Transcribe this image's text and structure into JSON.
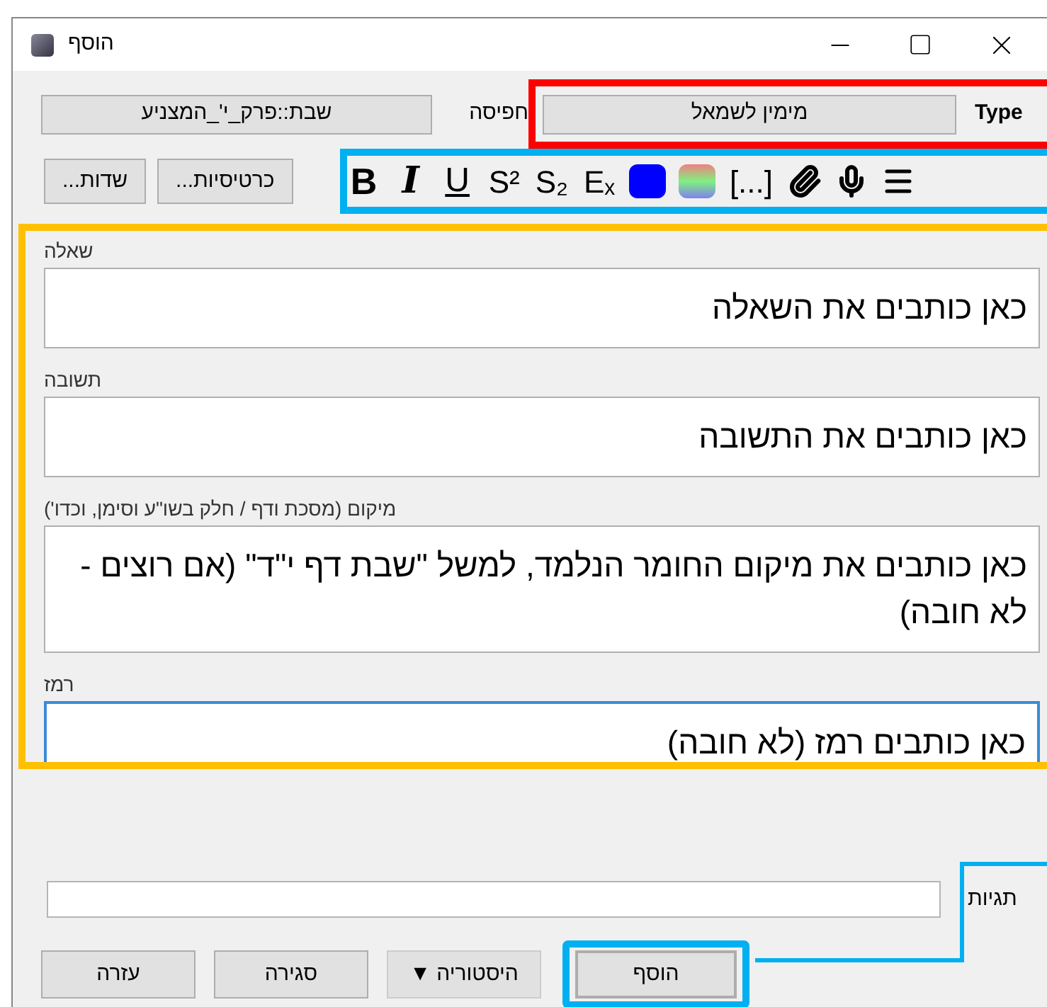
{
  "window": {
    "title": "הוסף"
  },
  "type": {
    "label": "Type",
    "value": "מימין לשמאל"
  },
  "deck": {
    "label": "חפיסה",
    "value": "שבת::פרק_י'_המצניע"
  },
  "top_buttons": [
    {
      "label": "כרטיסיות..."
    },
    {
      "label": "שדות..."
    }
  ],
  "toolbar": [
    {
      "kind": "menu"
    },
    {
      "kind": "record"
    },
    {
      "kind": "attach"
    },
    {
      "kind": "glyph",
      "glyph": "[...]"
    },
    {
      "kind": "highlight"
    },
    {
      "kind": "color",
      "color": "#0000ff"
    },
    {
      "kind": "glyph",
      "glyph": "Eₓ"
    },
    {
      "kind": "glyph",
      "glyph": "S₂"
    },
    {
      "kind": "glyph",
      "glyph": "S²"
    },
    {
      "kind": "underline",
      "glyph": "U"
    },
    {
      "kind": "italic",
      "glyph": "I"
    },
    {
      "kind": "bold",
      "glyph": "B"
    }
  ],
  "fields": [
    {
      "label": "שאלה",
      "value": "כאן כותבים את השאלה",
      "focused": false
    },
    {
      "label": "תשובה",
      "value": "כאן כותבים את התשובה",
      "focused": false
    },
    {
      "label": "מיקום (מסכת ודף / חלק בשו\"ע וסימן, וכדו')",
      "value": "כאן כותבים את מיקום החומר הנלמד, למשל \"שבת דף י\"ד\" (אם רוצים - לא חובה)",
      "focused": false
    },
    {
      "label": "רמז",
      "value": "כאן כותבים רמז (לא חובה)",
      "focused": true
    }
  ],
  "tags": {
    "label": "תגיות"
  },
  "bottom_buttons": [
    {
      "label": "הוסף",
      "disabled": false,
      "default": true
    },
    {
      "label": "היסטוריה ▼",
      "disabled": true,
      "default": false
    },
    {
      "label": "סגירה",
      "disabled": false,
      "default": false
    },
    {
      "label": "עזרה",
      "disabled": false,
      "default": false
    }
  ]
}
